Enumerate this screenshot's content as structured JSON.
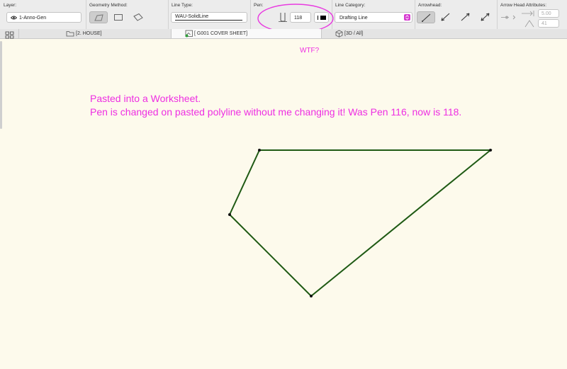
{
  "infobox": {
    "layer": {
      "label": "Layer:",
      "value": "1-Anno-Gen"
    },
    "geometry": {
      "label": "Geometry Method:"
    },
    "line_type": {
      "label": "Line Type:",
      "value": "WAU-SolidLine"
    },
    "pen": {
      "label": "Pen:",
      "value": "118"
    },
    "line_category": {
      "label": "Line Category:",
      "value": "Drafting Line"
    },
    "arrowhead": {
      "label": "Arrowhead:"
    },
    "arrow_attr": {
      "label": "Arrow Head Attributes:",
      "size1": "5.00",
      "size2": "41"
    }
  },
  "tabs": [
    "[2. HOUSE]",
    "[ G001 COVER SHEET]",
    "[3D / All]"
  ],
  "annotations": {
    "wtf": "WTF?",
    "line1": "Pasted into a Worksheet.",
    "line2": "Pen is changed on pasted polyline without me changing it! Was Pen 116, now is 118."
  },
  "colors": {
    "canvas": "#fdfaec",
    "polyline": "#1f5a14",
    "annotation": "#ee2ee2",
    "accent": "#d63ad0"
  },
  "icons": [
    "eye-icon",
    "polyline-geometry-icon",
    "rectangle-geometry-icon",
    "rotated-rectangle-geometry-icon",
    "pen-icon",
    "pen-color-swatch-icon",
    "dropdown-stepper-icon",
    "arrowhead-none-icon",
    "arrowhead-start-icon",
    "arrowhead-end-icon",
    "arrowhead-both-icon",
    "arrow-style-icon",
    "arrow-width-icon",
    "arrow-length-icon",
    "grid-view-icon",
    "folder-icon",
    "sheet-icon",
    "cube-3d-icon"
  ]
}
